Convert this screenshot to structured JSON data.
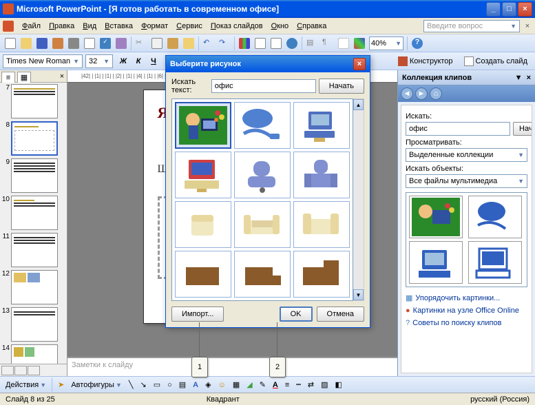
{
  "app": {
    "title": "Microsoft PowerPoint - [Я готов работать в современном офисе]"
  },
  "menu": {
    "file": "Файл",
    "edit": "Правка",
    "view": "Вид",
    "insert": "Вставка",
    "format": "Формат",
    "tools": "Сервис",
    "slideshow": "Показ слайдов",
    "window": "Окно",
    "help": "Справка",
    "help_placeholder": "Введите вопрос"
  },
  "toolbar": {
    "zoom": "40%"
  },
  "formatting": {
    "font": "Times New Roman",
    "size": "32",
    "designer": "Конструктор",
    "new_slide": "Создать слайд"
  },
  "slides": {
    "numbers": [
      "7",
      "8",
      "9",
      "10",
      "11",
      "12",
      "13",
      "14"
    ],
    "active": "8"
  },
  "canvas": {
    "title": "Я готов",
    "text": "Щ",
    "ruler": "|42| | |1| | |1| | |2| | |1| | |4| | |1| | |6| | |1| | |8| |"
  },
  "notes": {
    "placeholder": "Заметки к слайду"
  },
  "dialog": {
    "title": "Выберите рисунок",
    "search_label": "Искать текст:",
    "search_value": "офис",
    "begin": "Начать",
    "import": "Импорт...",
    "ok": "OK",
    "cancel": "Отмена"
  },
  "taskpane": {
    "title": "Коллекция клипов",
    "search_label": "Искать:",
    "search_value": "офис",
    "begin": "Начать",
    "browse_label": "Просматривать:",
    "browse_value": "Выделенные коллекции",
    "objects_label": "Искать объекты:",
    "objects_value": "Все файлы мультимедиа",
    "link_organize": "Упорядочить картинки...",
    "link_online": "Картинки на узле Office Online",
    "link_tips": "Советы по поиску клипов"
  },
  "bottom": {
    "actions": "Действия",
    "autoshapes": "Автофигуры"
  },
  "status": {
    "slide": "Слайд 8 из 25",
    "template": "Квадрант",
    "lang": "русский (Россия)"
  },
  "callouts": {
    "c1": "1",
    "c2": "2"
  }
}
